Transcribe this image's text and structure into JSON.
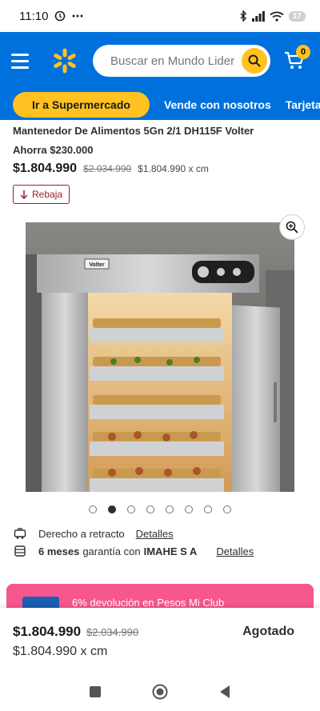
{
  "status_bar": {
    "time": "11:10",
    "battery": "17"
  },
  "header": {
    "search_placeholder": "Buscar en Mundo Lider",
    "cart_count": "0"
  },
  "nav": {
    "pill_label": "Ir a Supermercado",
    "links": [
      "Vende con nosotros",
      "Tarjeta"
    ]
  },
  "product": {
    "title": "Mantenedor De Alimentos 5Gn 2/1 DH115F Volter",
    "saving": "Ahorra $230.000",
    "price": "$1.804.990",
    "old_price": "$2.034.990",
    "unit_price": "$1.804.990 x cm",
    "badge": "Rebaja",
    "image_brand": "Volter"
  },
  "carousel": {
    "total": 8,
    "active_index": 1
  },
  "info": {
    "return_text": "Derecho a retracto",
    "return_link": "Detalles",
    "warranty_bold": "6 meses",
    "warranty_text": "garantía con",
    "warranty_provider": "IMAHE S A",
    "warranty_link": "Detalles"
  },
  "banner": {
    "text": "6% devolución en Pesos Mi Club"
  },
  "bottom_bar": {
    "price": "$1.804.990",
    "old_price": "$2.034.990",
    "unit_price": "$1.804.990 x cm",
    "status": "Agotado"
  },
  "colors": {
    "brand_blue": "#0071dc",
    "spark_yellow": "#ffc220",
    "rebaja_red": "#9b1c2e",
    "banner_pink": "#f7578f"
  }
}
